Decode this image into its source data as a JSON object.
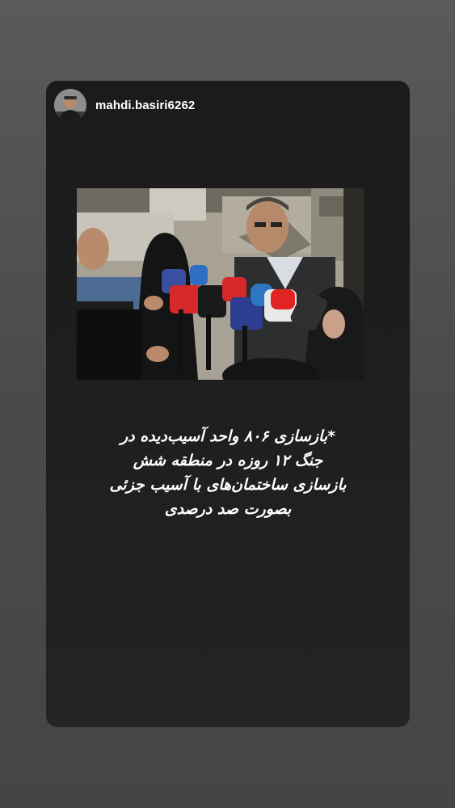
{
  "story": {
    "username": "mahdi.basiri6262",
    "caption_lines": [
      "*بازسازی ۸۰۶ واحد آسیب‌دیده در",
      "جنگ ۱۲ روزه در منطقه شش",
      "بازسازی ساختمان‌های با آسیب جزئی",
      "بصورت صد درصدی"
    ]
  }
}
